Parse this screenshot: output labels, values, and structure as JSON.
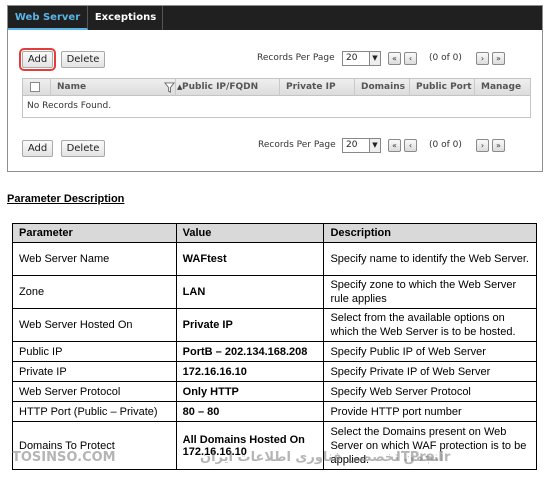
{
  "tabs": [
    {
      "label": "Web Server",
      "active": true
    },
    {
      "label": "Exceptions",
      "active": false
    }
  ],
  "toolbar_top": {
    "add_label": "Add",
    "delete_label": "Delete",
    "records_per_page_label": "Records Per Page",
    "records_per_page_value": "20",
    "page_count": "(0 of 0)"
  },
  "grid": {
    "columns": [
      "Name",
      "Public IP/FQDN",
      "Private IP",
      "Domains",
      "Public Port",
      "Manage"
    ],
    "empty_message": "No Records Found."
  },
  "toolbar_bottom": {
    "add_label": "Add",
    "delete_label": "Delete",
    "records_per_page_label": "Records Per Page",
    "records_per_page_value": "20",
    "page_count": "(0 of 0)"
  },
  "pager_icons": [
    "first-page-icon",
    "previous-page-icon",
    "next-page-icon",
    "last-page-icon"
  ],
  "accent_color": "#5ab4e6",
  "highlight_color": "#e43b3b",
  "parameter_heading": "Parameter Description",
  "param_table": {
    "headers": [
      "Parameter",
      "Value",
      "Description"
    ],
    "rows": [
      {
        "parameter": "Web Server Name",
        "value": "WAFtest",
        "description": "Specify name to identify the Web Server."
      },
      {
        "parameter": "Zone",
        "value": "LAN",
        "description": "Specify zone to which the Web Server rule applies"
      },
      {
        "parameter": "Web Server Hosted On",
        "value": "Private IP",
        "description": "Select from the available options on which the Web Server is to be hosted."
      },
      {
        "parameter": "Public IP",
        "value": "PortB – 202.134.168.208",
        "description": "Specify Public IP of Web Server"
      },
      {
        "parameter": "Private IP",
        "value": "172.16.16.10",
        "description": "Specify Private IP of Web Server"
      },
      {
        "parameter": "Web Server Protocol",
        "value": "Only HTTP",
        "description": "Specify Web Server Protocol"
      },
      {
        "parameter": "HTTP Port (Public – Private)",
        "value": "80 – 80",
        "description": "Provide HTTP port number"
      },
      {
        "parameter": "Domains To Protect",
        "value": "All Domains Hosted On 172.16.16.10",
        "description": "Select the Domains present on Web Server on which WAF protection is to be applied."
      }
    ]
  },
  "watermark": {
    "left": "TOSINSO.COM",
    "middle": "انجمن تخصصی فناوری اطلاعات ایران",
    "right": "ITPro.ir"
  }
}
